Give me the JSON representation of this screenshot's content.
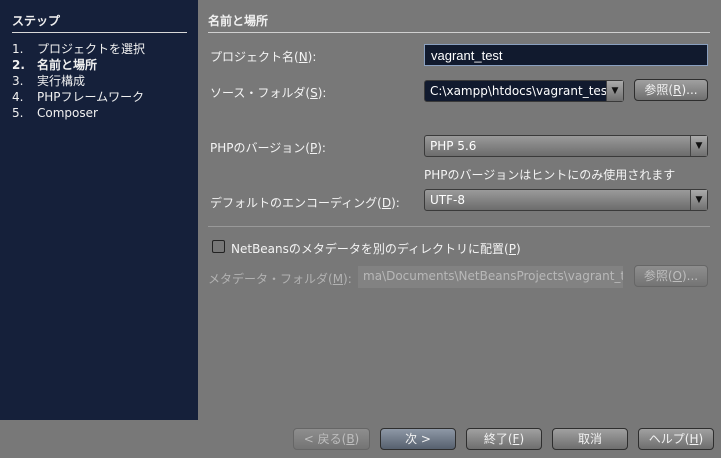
{
  "sidebar": {
    "title": "ステップ",
    "steps": [
      {
        "num": "1.",
        "label": "プロジェクトを選択"
      },
      {
        "num": "2.",
        "label": "名前と場所"
      },
      {
        "num": "3.",
        "label": "実行構成"
      },
      {
        "num": "4.",
        "label": "PHPフレームワーク"
      },
      {
        "num": "5.",
        "label": "Composer"
      }
    ]
  },
  "main": {
    "title": "名前と場所",
    "project_name": {
      "label": "プロジェクト名(",
      "key": "N",
      "end": "):",
      "value": "vagrant_test"
    },
    "source_folder": {
      "label": "ソース・フォルダ(",
      "key": "S",
      "end": "):",
      "value": "C:\\xampp\\htdocs\\vagrant_test",
      "browse": "参照(",
      "browse_key": "R",
      "browse_end": ")..."
    },
    "php_version": {
      "label": "PHPのバージョン(",
      "key": "P",
      "end": "):",
      "value": "PHP 5.6",
      "hint": "PHPのバージョンはヒントにのみ使用されます"
    },
    "encoding": {
      "label": "デフォルトのエンコーディング(",
      "key": "D",
      "end": "):",
      "value": "UTF-8"
    },
    "metadata_checkbox": {
      "label": "NetBeansのメタデータを別のディレクトリに配置(",
      "key": "P",
      "end": ")",
      "checked": false
    },
    "metadata_folder": {
      "label": "メタデータ・フォルダ(",
      "key": "M",
      "end": "):",
      "value": "ma\\Documents\\NetBeansProjects\\vagrant_test",
      "browse": "参照(",
      "browse_key": "O",
      "browse_end": ")..."
    }
  },
  "footer": {
    "back": "< 戻る(",
    "back_key": "B",
    "back_end": ")",
    "next": "次 >",
    "finish": "終了(",
    "finish_key": "F",
    "finish_end": ")",
    "cancel": "取消",
    "help": "ヘルプ(",
    "help_key": "H",
    "help_end": ")"
  }
}
